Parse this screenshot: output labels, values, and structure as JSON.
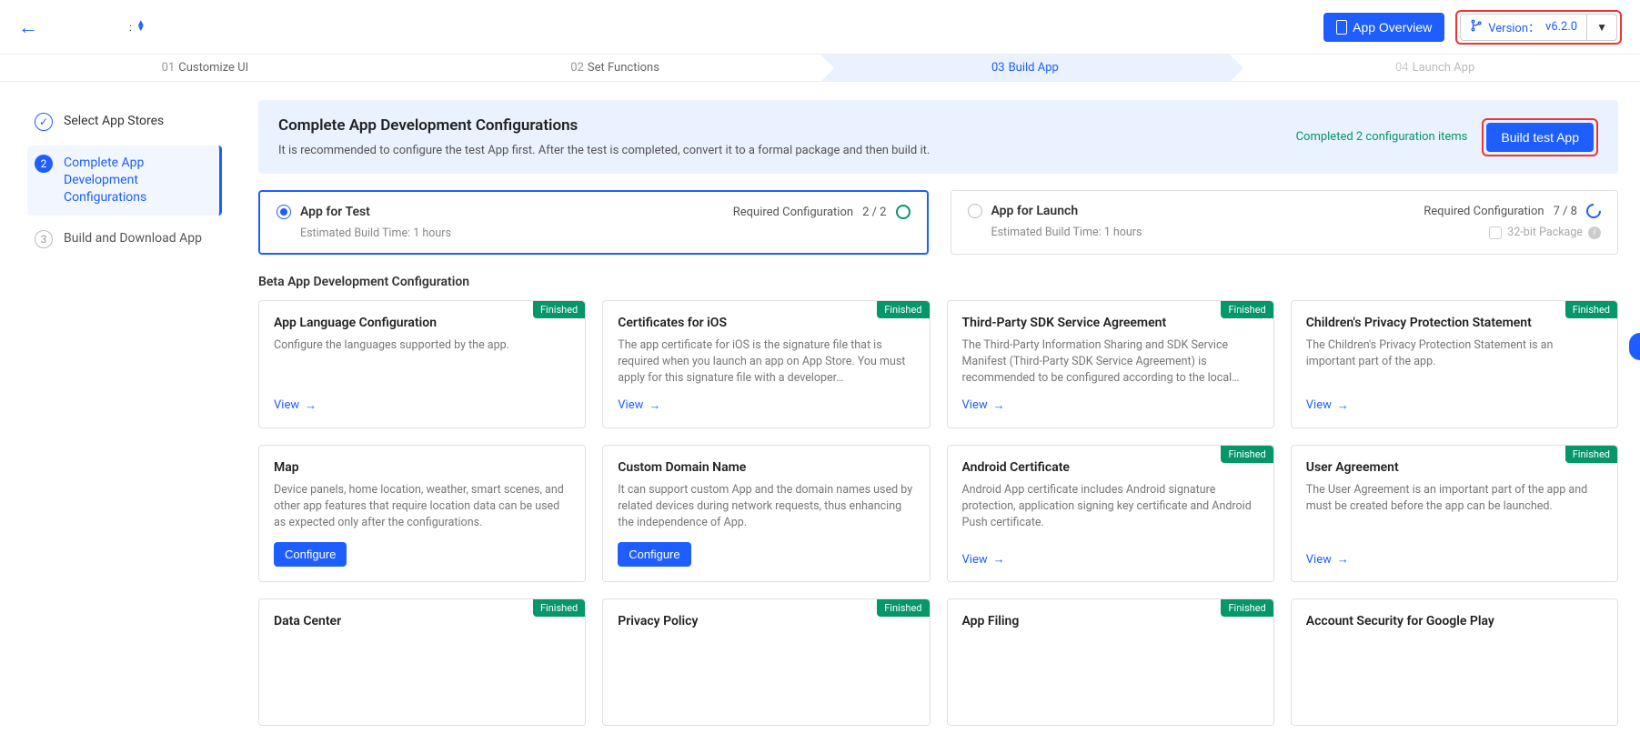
{
  "topbar": {
    "overview_label": "App Overview",
    "version_label": "Version：",
    "version_value": "v6.2.0",
    "mid_fragment": ":"
  },
  "steps": [
    {
      "num": "01",
      "label": "Customize UI"
    },
    {
      "num": "02",
      "label": "Set Functions"
    },
    {
      "num": "03",
      "label": "Build App"
    },
    {
      "num": "04",
      "label": "Launch App"
    }
  ],
  "sidebar": {
    "items": [
      {
        "label": "Select App Stores",
        "state": "done",
        "mark": "✓"
      },
      {
        "label": "Complete App Development Configurations",
        "state": "active",
        "mark": "2"
      },
      {
        "label": "Build and Download App",
        "state": "pending",
        "mark": "3"
      }
    ]
  },
  "banner": {
    "title": "Complete App Development Configurations",
    "subtitle": "It is recommended to configure the test App first. After the test is completed, convert it to a formal package and then build it.",
    "completed_text": "Completed 2 configuration items",
    "build_label": "Build test App"
  },
  "radio": {
    "test": {
      "title": "App for Test",
      "req_label": "Required Configuration",
      "req_count": "2 / 2",
      "sub": "Estimated Build Time: 1 hours"
    },
    "launch": {
      "title": "App for Launch",
      "req_label": "Required Configuration",
      "req_count": "7 / 8",
      "sub": "Estimated Build Time: 1 hours",
      "pkg_label": "32-bit Package"
    }
  },
  "section_title": "Beta App Development Configuration",
  "labels": {
    "finished": "Finished",
    "view": "View",
    "configure": "Configure"
  },
  "cards_row1": [
    {
      "title": "App Language Configuration",
      "desc": "Configure the languages supported by the app.",
      "action": "view",
      "finished": true
    },
    {
      "title": "Certificates for iOS",
      "desc": "The app certificate for iOS is the signature file that is required when you launch an app on App Store. You must apply for this signature file with a developer…",
      "action": "view",
      "finished": true
    },
    {
      "title": "Third-Party SDK Service Agreement",
      "desc": "The Third-Party Information Sharing and SDK Service Manifest (Third-Party SDK Service Agreement) is recommended to be configured according to the local…",
      "action": "view",
      "finished": true
    },
    {
      "title": "Children's Privacy Protection Statement",
      "desc": "The Children's Privacy Protection Statement is an important part of the app.",
      "action": "view",
      "finished": true
    }
  ],
  "cards_row2": [
    {
      "title": "Map",
      "desc": "Device panels, home location, weather, smart scenes, and other app features that require location data can be used as expected only after the configurations.",
      "action": "configure",
      "finished": false
    },
    {
      "title": "Custom Domain Name",
      "desc": "It can support custom App and the domain names used by related devices during network requests, thus enhancing the independence of App.",
      "action": "configure",
      "finished": false
    },
    {
      "title": "Android Certificate",
      "desc": "Android App certificate includes Android signature protection, application signing key certificate and Android Push certificate.",
      "action": "view",
      "finished": true
    },
    {
      "title": "User Agreement",
      "desc": "The User Agreement is an important part of the app and must be created before the app can be launched.",
      "action": "view",
      "finished": true
    }
  ],
  "cards_row3": [
    {
      "title": "Data Center",
      "desc": "",
      "action": "",
      "finished": true
    },
    {
      "title": "Privacy Policy",
      "desc": "",
      "action": "",
      "finished": true
    },
    {
      "title": "App Filing",
      "desc": "",
      "action": "",
      "finished": true
    },
    {
      "title": "Account Security for Google Play",
      "desc": "",
      "action": "",
      "finished": false
    }
  ]
}
